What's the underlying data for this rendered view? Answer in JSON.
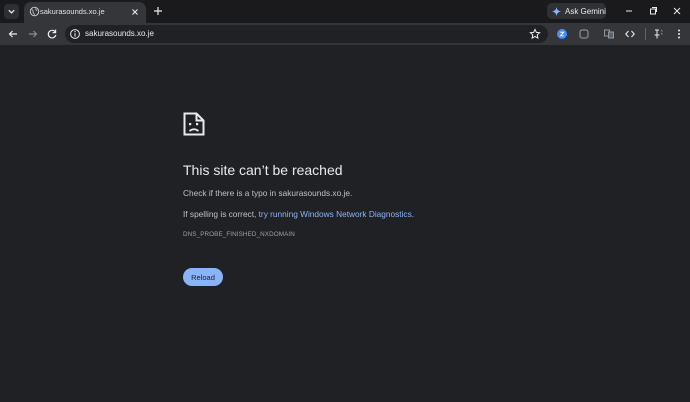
{
  "tab": {
    "title": "sakurasounds.xo.je"
  },
  "gemini": {
    "label": "Ask Gemini"
  },
  "omnibox": {
    "url": "sakurasounds.xo.je"
  },
  "icons": {
    "tab_search": "chevron-down-icon",
    "favicon": "globe-icon",
    "tab_close": "close-icon",
    "new_tab": "plus-icon",
    "gemini": "sparkle-icon",
    "back": "arrow-left-icon",
    "forward": "arrow-right-icon",
    "reload": "reload-icon",
    "site_info": "info-icon",
    "bookmark": "star-icon",
    "extensions": [
      "blue-circle-extension-icon",
      "translate-icon",
      "code-icon",
      "pin-icon",
      "menu-icon"
    ],
    "error": "sad-document-icon"
  },
  "colors": {
    "accent": "#8ab4f8",
    "page_background": "#202124"
  },
  "error": {
    "title": "This site can’t be reached",
    "line1": "Check if there is a typo in sakurasounds.xo.je.",
    "line2_prefix": "If spelling is correct, ",
    "line2_link": "try running Windows Network Diagnostics",
    "line2_suffix": ".",
    "code": "DNS_PROBE_FINISHED_NXDOMAIN",
    "reload_label": "Reload"
  }
}
